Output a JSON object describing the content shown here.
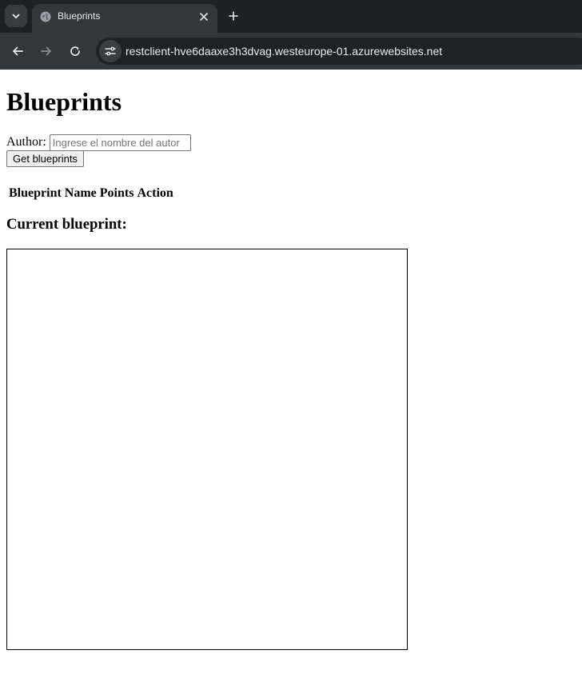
{
  "browser": {
    "tab_title": "Blueprints",
    "url": "restclient-hve6daaxe3h3dvag.westeurope-01.azurewebsites.net",
    "icons": [
      "tab-search-icon",
      "globe-icon",
      "close-icon",
      "plus-icon",
      "back-arrow-icon",
      "forward-arrow-icon",
      "reload-icon",
      "site-settings-icon"
    ]
  },
  "page": {
    "title": "Blueprints",
    "author_label": "Author:",
    "author_input": {
      "value": "",
      "placeholder": "Ingrese el nombre del autor"
    },
    "get_button_label": "Get blueprints",
    "table": {
      "headers": [
        "Blueprint Name",
        "Points",
        "Action"
      ],
      "rows": []
    },
    "current_blueprint_label": "Current blueprint:"
  }
}
